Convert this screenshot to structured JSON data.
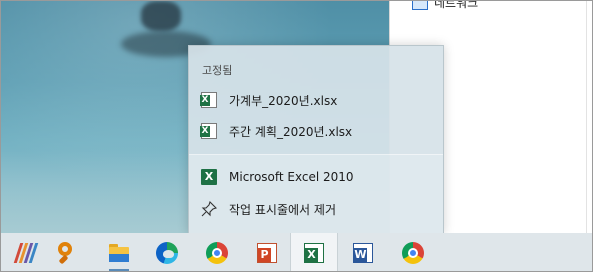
{
  "explorer": {
    "network_label": "네트워크"
  },
  "jumplist": {
    "pinned_header": "고정됨",
    "pinned_items": [
      {
        "label": "가계부_2020년.xlsx",
        "icon": "excel-file-icon"
      },
      {
        "label": "주간 계획_2020년.xlsx",
        "icon": "excel-file-icon"
      }
    ],
    "tasks": [
      {
        "label": "Microsoft Excel 2010",
        "icon": "excel-app-icon"
      },
      {
        "label": "작업 표시줄에서 제거",
        "icon": "unpin-icon"
      }
    ]
  },
  "taskbar": {
    "items": [
      {
        "name": "app-launcher",
        "icon": "stripes-app-icon"
      },
      {
        "name": "search",
        "icon": "search-icon"
      },
      {
        "name": "file-explorer",
        "icon": "folder-icon",
        "running": true
      },
      {
        "name": "edge",
        "icon": "edge-icon"
      },
      {
        "name": "chrome",
        "icon": "chrome-icon"
      },
      {
        "name": "powerpoint",
        "icon": "powerpoint-icon"
      },
      {
        "name": "excel",
        "icon": "excel-icon",
        "active": true
      },
      {
        "name": "word",
        "icon": "word-icon"
      },
      {
        "name": "chrome-2",
        "icon": "chrome-icon"
      }
    ]
  },
  "colors": {
    "taskbar_bg": "#dfe6ea",
    "jumplist_bg": "#d6e2e8",
    "excel_green": "#1f7244"
  }
}
